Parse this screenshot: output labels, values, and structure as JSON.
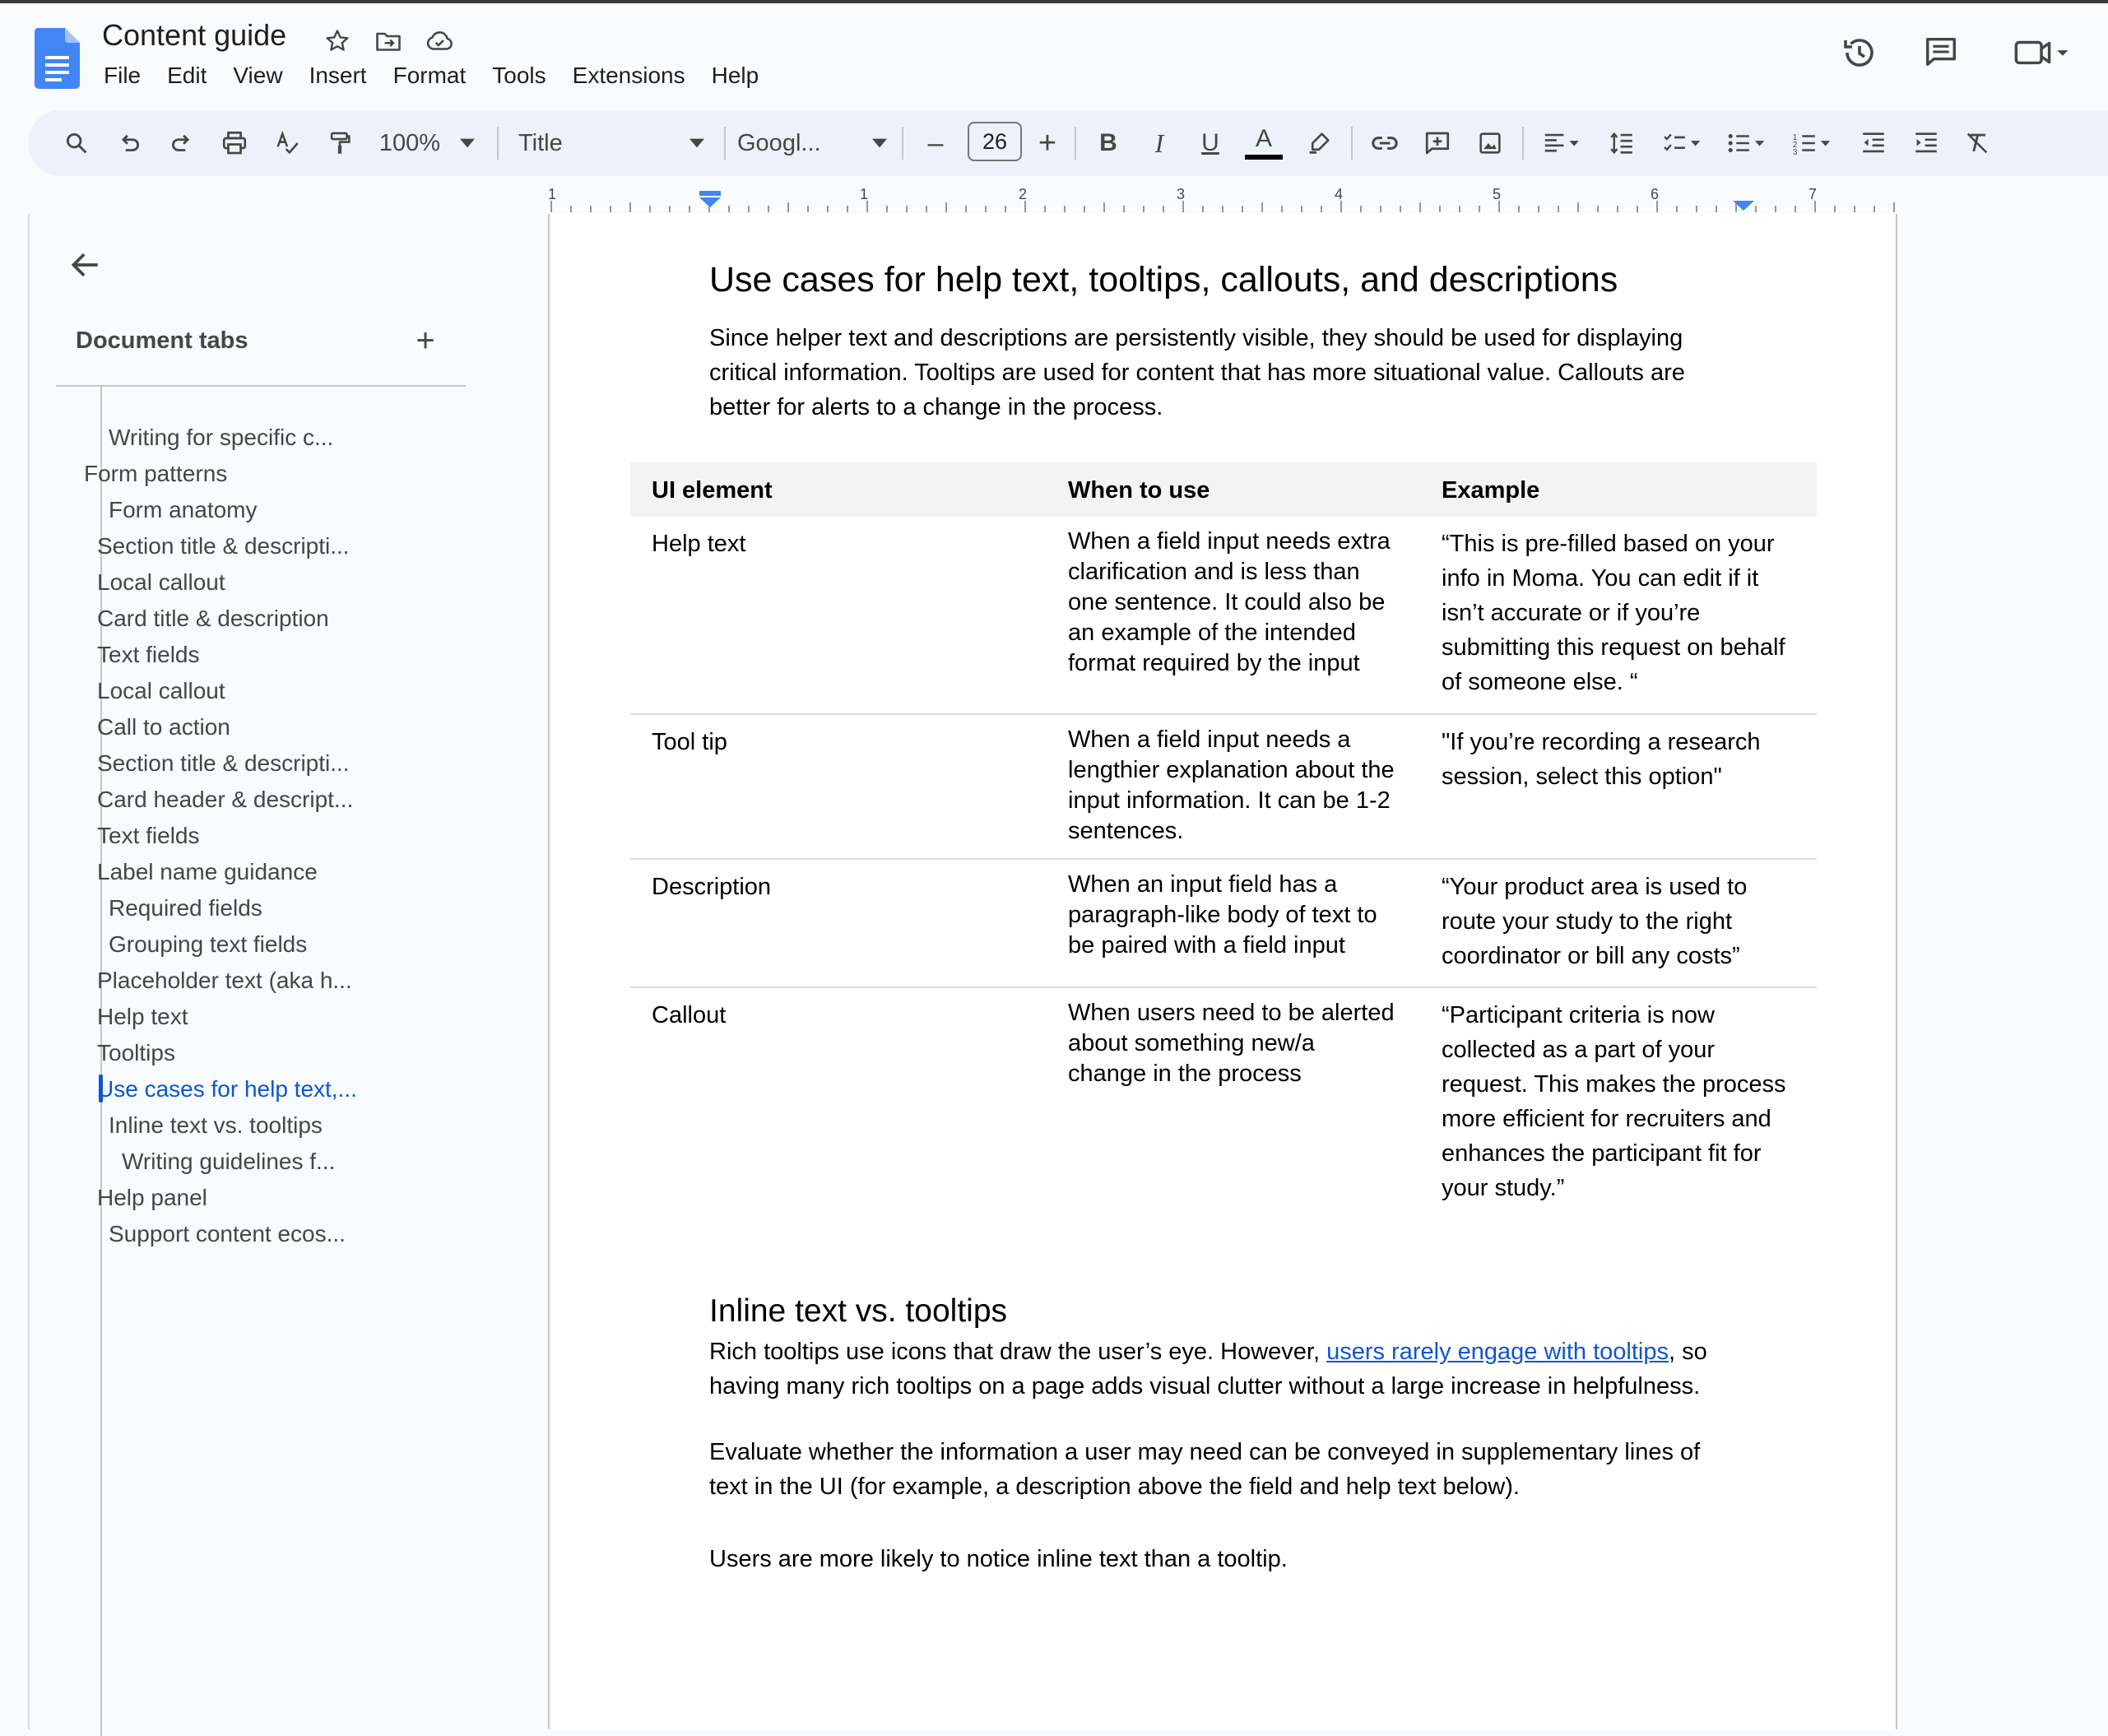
{
  "doc": {
    "title": "Content guide"
  },
  "menu": [
    "File",
    "Edit",
    "View",
    "Insert",
    "Format",
    "Tools",
    "Extensions",
    "Help"
  ],
  "toolbar": {
    "zoom": "100%",
    "style": "Title",
    "font": "Googl...",
    "font_size": "26",
    "decrease": "–",
    "increase": "+"
  },
  "ruler": {
    "marks": [
      "1",
      "1",
      "2",
      "3",
      "4",
      "5",
      "6",
      "7"
    ]
  },
  "sidebar": {
    "heading": "Document tabs",
    "add_label": "+",
    "items": [
      {
        "label": "Writing for specific c...",
        "level": 3
      },
      {
        "label": "Form patterns",
        "level": 1
      },
      {
        "label": "Form anatomy",
        "level": 3
      },
      {
        "label": "Section title & descripti...",
        "level": 2
      },
      {
        "label": "Local callout",
        "level": 2
      },
      {
        "label": "Card title & description",
        "level": 2
      },
      {
        "label": "Text fields",
        "level": 2
      },
      {
        "label": "Local callout",
        "level": 2
      },
      {
        "label": "Call to action",
        "level": 2
      },
      {
        "label": "Section title & descripti...",
        "level": 2
      },
      {
        "label": "Card header & descript...",
        "level": 2
      },
      {
        "label": "Text fields",
        "level": 2
      },
      {
        "label": "Label name guidance",
        "level": 2
      },
      {
        "label": "Required fields",
        "level": 3
      },
      {
        "label": "Grouping text fields",
        "level": 3
      },
      {
        "label": "Placeholder text (aka h...",
        "level": 2
      },
      {
        "label": "Help text",
        "level": 2
      },
      {
        "label": "Tooltips",
        "level": 2
      },
      {
        "label": "Use cases for help text,...",
        "level": 2,
        "active": true
      },
      {
        "label": "Inline text vs. tooltips",
        "level": 3
      },
      {
        "label": "Writing guidelines f...",
        "level": 4
      },
      {
        "label": "Help panel",
        "level": 2
      },
      {
        "label": "Support content ecos...",
        "level": 3
      }
    ]
  },
  "content": {
    "heading": "Use cases for help text, tooltips, callouts, and descriptions",
    "intro": "Since helper text and descriptions are persistently visible, they should be used for displaying critical information. Tooltips are used for content that has more situational value. Callouts are better for alerts to a change in the process.",
    "table": {
      "headers": [
        "UI element",
        "When to use",
        "Example"
      ],
      "rows": [
        [
          "Help text",
          "When a field input needs extra clarification and is less than one sentence. It could also be an example of the intended format required by the input",
          "“This is pre-filled based on your info in Moma. You can edit if it isn’t accurate or if you’re submitting this request on behalf of someone else. “"
        ],
        [
          "Tool tip",
          "When a field input needs a lengthier explanation about the input information. It can be 1-2 sentences.",
          "\"If you’re recording a research session, select this option\""
        ],
        [
          "Description",
          "When an input field has a paragraph-like body of text to be paired with a field input",
          "“Your product area is used to route your study to the right coordinator or bill any costs”"
        ],
        [
          "Callout",
          "When users need to be alerted about something new/a change in the process",
          "“Participant criteria is now collected as a part of your request. This makes the process more efficient for recruiters and enhances the participant fit for your study.”"
        ]
      ]
    },
    "subheading": "Inline text vs. tooltips",
    "p1_before": "Rich tooltips use icons that draw the user’s eye. However, ",
    "p1_link": "users rarely engage with tooltips",
    "p1_after": ", so having many rich tooltips on a page adds visual clutter without a large increase in helpfulness.",
    "p2": "Evaluate whether the information a user may need can be conveyed in supplementary lines of text in the UI (for example, a description above the field and help text below).",
    "p3": "Users are more likely to notice inline text than a tooltip."
  }
}
